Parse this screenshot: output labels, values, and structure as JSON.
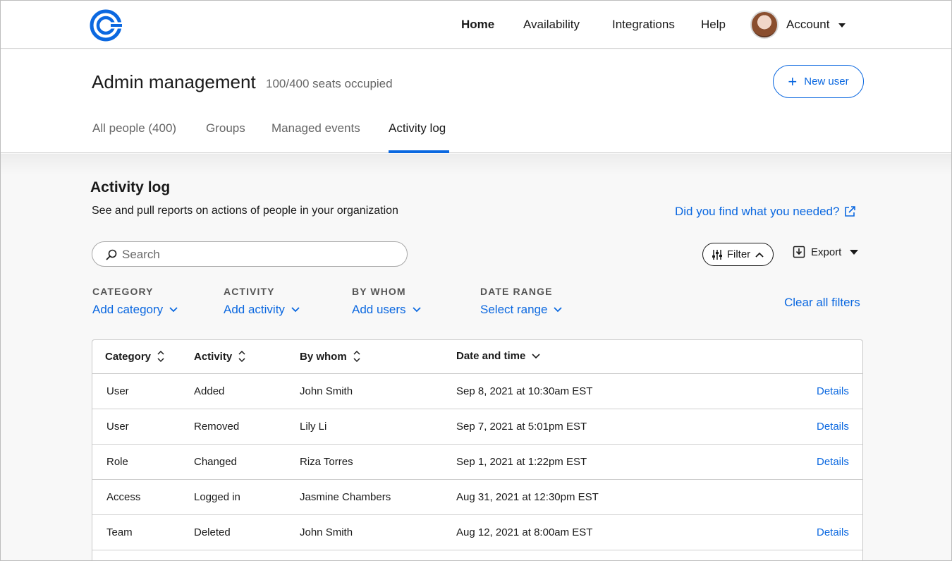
{
  "nav": {
    "items": [
      {
        "label": "Home",
        "active": true
      },
      {
        "label": "Availability",
        "active": false
      },
      {
        "label": "Integrations",
        "active": false
      },
      {
        "label": "Help",
        "active": false
      }
    ],
    "account_label": "Account",
    "logo_icon": "calendly-logo-icon",
    "brand_color": "#0b68e0"
  },
  "header": {
    "title": "Admin management",
    "seats": "100/400 seats occupied",
    "new_user_label": "New user",
    "tabs": [
      {
        "label": "All people (400)",
        "active": false
      },
      {
        "label": "Groups",
        "active": false
      },
      {
        "label": "Managed events",
        "active": false
      },
      {
        "label": "Activity log",
        "active": true
      }
    ]
  },
  "activity": {
    "title": "Activity log",
    "description": "See and pull reports on actions of people in your organization",
    "help_link": "Did you find what you needed?",
    "search_placeholder": "Search",
    "filter_label": "Filter",
    "export_label": "Export",
    "filters": [
      {
        "label": "CATEGORY",
        "value": "Add category"
      },
      {
        "label": "ACTIVITY",
        "value": "Add activity"
      },
      {
        "label": "BY WHOM",
        "value": "Add users"
      },
      {
        "label": "DATE RANGE",
        "value": "Select range"
      }
    ],
    "clear_filters": "Clear all filters"
  },
  "table": {
    "columns": [
      "Category",
      "Activity",
      "By whom",
      "Date and time"
    ],
    "details_label": "Details",
    "rows": [
      {
        "category": "User",
        "activity": "Added",
        "by_whom": "John Smith",
        "datetime": "Sep 8, 2021 at 10:30am EST",
        "details": "Details"
      },
      {
        "category": "User",
        "activity": "Removed",
        "by_whom": "Lily Li",
        "datetime": "Sep 7, 2021 at 5:01pm EST",
        "details": "Details"
      },
      {
        "category": "Role",
        "activity": "Changed",
        "by_whom": "Riza Torres",
        "datetime": "Sep 1, 2021 at 1:22pm EST",
        "details": "Details"
      },
      {
        "category": "Access",
        "activity": "Logged in",
        "by_whom": "Jasmine Chambers",
        "datetime": "Aug 31, 2021 at 12:30pm EST",
        "details": ""
      },
      {
        "category": "Team",
        "activity": "Deleted",
        "by_whom": "John Smith",
        "datetime": "Aug 12, 2021 at 8:00am EST",
        "details": "Details"
      }
    ]
  }
}
